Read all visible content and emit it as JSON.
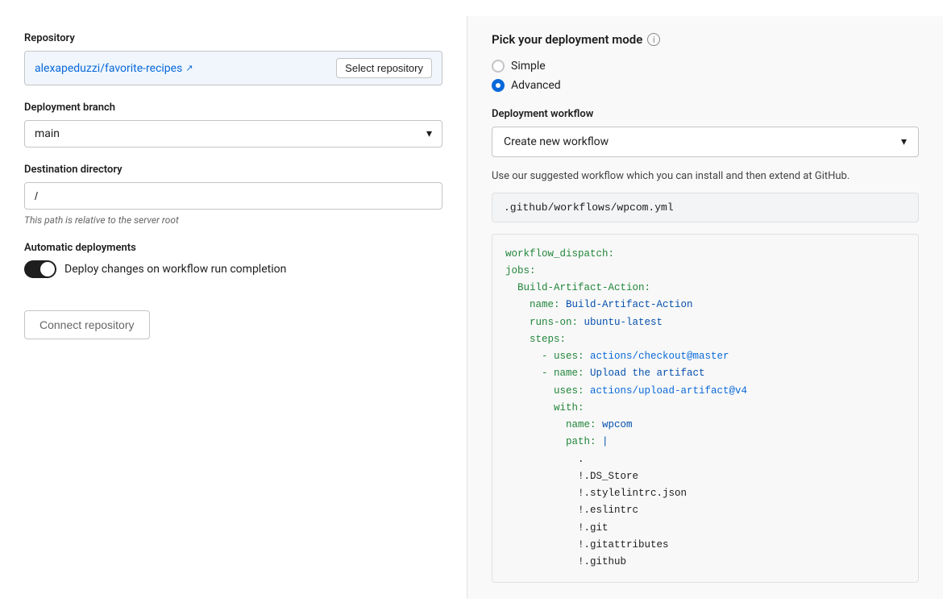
{
  "left": {
    "repository_label": "Repository",
    "repo_link_text": "alexapeduzzi/favorite-recipes",
    "repo_link_icon": "↗",
    "select_repo_btn": "Select repository",
    "deployment_branch_label": "Deployment branch",
    "branch_value": "main",
    "destination_dir_label": "Destination directory",
    "destination_dir_value": "/",
    "hint_text": "This path is relative to the server root",
    "auto_deploy_label": "Automatic deployments",
    "auto_deploy_toggle_label": "Deploy changes on workflow run completion",
    "connect_btn": "Connect repository"
  },
  "right": {
    "deploy_mode_title": "Pick your deployment mode",
    "radio_simple": "Simple",
    "radio_advanced": "Advanced",
    "workflow_label": "Deployment workflow",
    "workflow_value": "Create new workflow",
    "suggested_text": "Use our suggested workflow which you can install and then extend at GitHub.",
    "filepath": ".github/workflows/wpcom.yml",
    "code_lines": [
      {
        "indent": 0,
        "text": "workflow_dispatch:",
        "color": "green"
      },
      {
        "indent": 0,
        "text": "jobs:",
        "color": "green"
      },
      {
        "indent": 2,
        "text": "Build-Artifact-Action:",
        "color": "green"
      },
      {
        "indent": 4,
        "text": "name: ",
        "color": "green",
        "value": "Build-Artifact-Action",
        "value_color": "blue"
      },
      {
        "indent": 4,
        "text": "runs-on: ",
        "color": "green",
        "value": "ubuntu-latest",
        "value_color": "blue"
      },
      {
        "indent": 4,
        "text": "steps:",
        "color": "green"
      },
      {
        "indent": 6,
        "text": "- uses: ",
        "color": "green",
        "value": "actions/checkout@master",
        "value_color": "teal"
      },
      {
        "indent": 6,
        "text": "- name: ",
        "color": "green",
        "value": "Upload the artifact",
        "value_color": "blue"
      },
      {
        "indent": 8,
        "text": "uses: ",
        "color": "green",
        "value": "actions/upload-artifact@v4",
        "value_color": "teal"
      },
      {
        "indent": 8,
        "text": "with:",
        "color": "green"
      },
      {
        "indent": 10,
        "text": "name: ",
        "color": "green",
        "value": "wpcom",
        "value_color": "blue"
      },
      {
        "indent": 10,
        "text": "path: ",
        "color": "green",
        "value": "|",
        "value_color": "blue"
      },
      {
        "indent": 12,
        "text": ".",
        "color": "default"
      },
      {
        "indent": 12,
        "text": "!.DS_Store",
        "color": "default"
      },
      {
        "indent": 12,
        "text": "!.stylelintrc.json",
        "color": "default"
      },
      {
        "indent": 12,
        "text": "!.eslintrc",
        "color": "default"
      },
      {
        "indent": 12,
        "text": "!.git",
        "color": "default"
      },
      {
        "indent": 12,
        "text": "!.gitattributes",
        "color": "default"
      },
      {
        "indent": 12,
        "text": "!.github",
        "color": "default"
      }
    ]
  }
}
